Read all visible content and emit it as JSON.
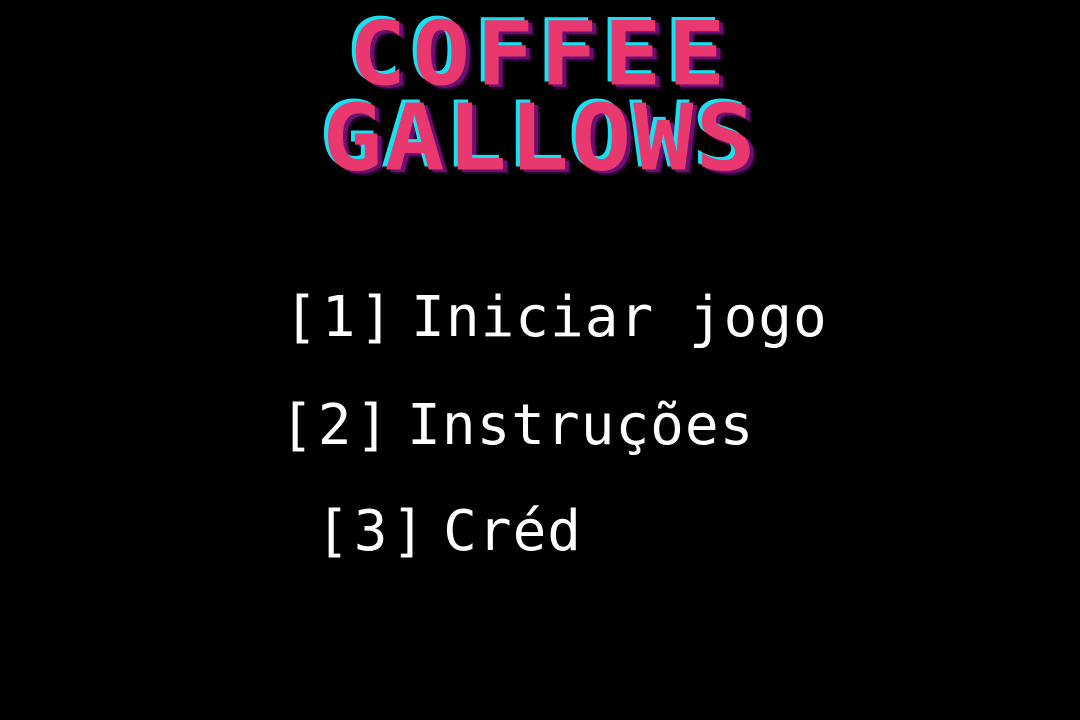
{
  "title": {
    "line1": "COFFEE",
    "line2": "GALLOWS",
    "colors": {
      "fill": "#e8386e",
      "shadow_cyan": "#18e0f0",
      "shadow_purple": "#6a1070"
    }
  },
  "menu": {
    "items": [
      {
        "key": "[1]",
        "label": "Iniciar jogo"
      },
      {
        "key": "[2]",
        "label": "Instruções"
      },
      {
        "key": "[3]",
        "label": "Créd"
      }
    ]
  },
  "theme": {
    "background": "#000000",
    "text": "#ffffff"
  }
}
